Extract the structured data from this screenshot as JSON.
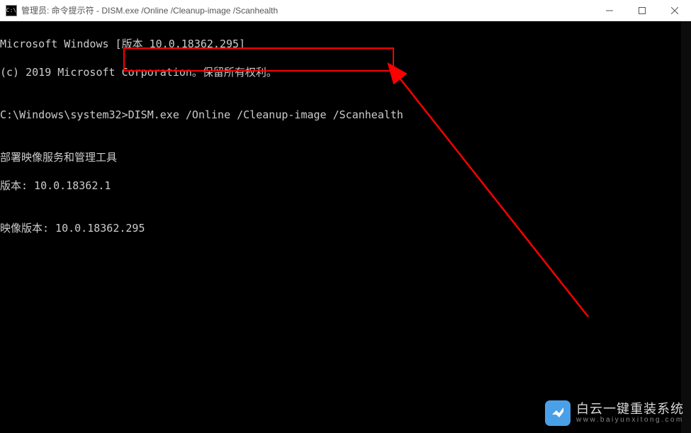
{
  "titlebar": {
    "icon_label": "C:\\",
    "text": "管理员: 命令提示符 - DISM.exe  /Online /Cleanup-image /Scanhealth"
  },
  "window_controls": {
    "minimize": "minimize",
    "maximize": "maximize",
    "close": "close"
  },
  "terminal": {
    "line1": "Microsoft Windows [版本 10.0.18362.295]",
    "line2": "(c) 2019 Microsoft Corporation。保留所有权利。",
    "blank1": "",
    "prompt_path": "C:\\Windows\\system32>",
    "prompt_command": "DISM.exe /Online /Cleanup-image /Scanhealth",
    "blank2": "",
    "line3": "部署映像服务和管理工具",
    "line4": "版本: 10.0.18362.1",
    "blank3": "",
    "line5": "映像版本: 10.0.18362.295",
    "blank4": "",
    "blank5": ""
  },
  "watermark": {
    "title": "白云一键重装系统",
    "url": "www.baiyunxitong.com"
  }
}
